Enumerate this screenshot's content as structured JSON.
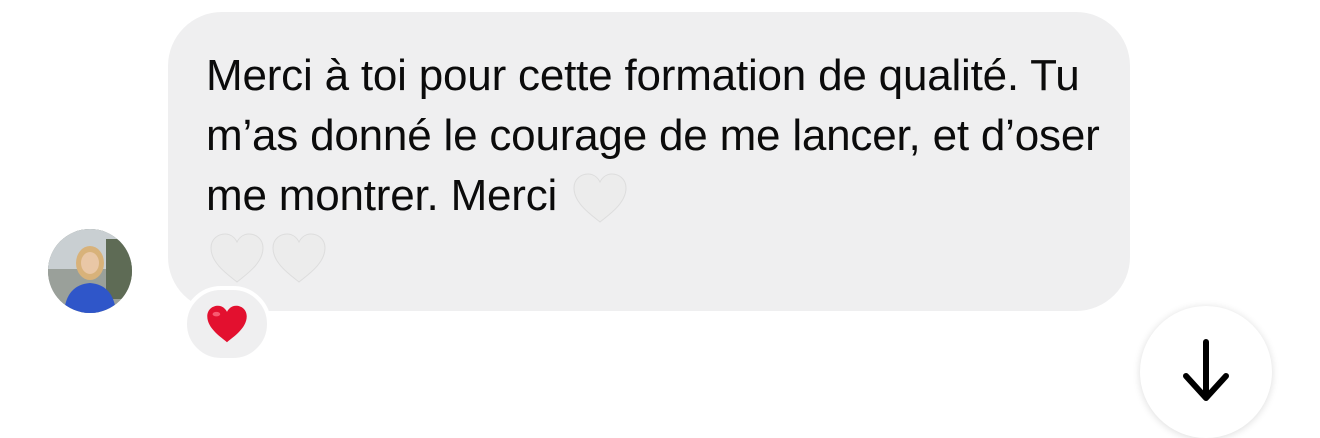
{
  "message": {
    "text_part1": "Merci à toi pour cette formation de qualité. Tu m’as donné le courage de me lancer, et d’oser me montrer. Merci ",
    "emojis": [
      "white-heart",
      "white-heart",
      "white-heart"
    ],
    "reaction": "red-heart"
  },
  "colors": {
    "bubble": "#efeff0",
    "text": "#0b0b0b",
    "white_heart": "#ececec",
    "red_heart": "#e3102f"
  }
}
